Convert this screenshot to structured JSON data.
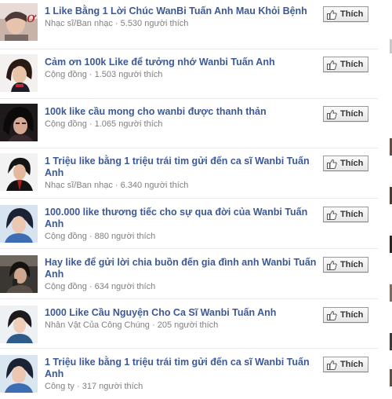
{
  "results": [
    {
      "title": "1 Like Bằng 1 Lời Chúc WanBi Tuấn Anh Mau Khỏi Bệnh",
      "category": "Nhạc sĩ/Ban nhạc",
      "likes": "5.530 người thích",
      "button": "Thích"
    },
    {
      "title": "Cảm ơn 100k Like để tưởng nhớ Wanbi Tuấn Anh",
      "category": "Cộng đồng",
      "likes": "1.503 người thích",
      "button": "Thích"
    },
    {
      "title": "100k like cầu mong cho wanbi được thanh thản",
      "category": "Cộng đồng",
      "likes": "1.065 người thích",
      "button": "Thích"
    },
    {
      "title": "1 Triệu like bằng 1 triệu trái tim gửi đến ca sĩ Wanbi Tuấn Anh",
      "category": "Nhạc sĩ/Ban nhạc",
      "likes": "6.340 người thích",
      "button": "Thích"
    },
    {
      "title": "100.000 like thương tiếc cho sự qua đời của Wanbi Tuấn Anh",
      "category": "Cộng đồng",
      "likes": "880 người thích",
      "button": "Thích"
    },
    {
      "title": "Hay like để gửi lời chia buồn đến gia đình anh Wanbi Tuấn Anh",
      "category": "Cộng đồng",
      "likes": "634 người thích",
      "button": "Thích"
    },
    {
      "title": "1000 Like Cầu Nguyện Cho Ca Sĩ Wanbi Tuấn Anh",
      "category": "Nhân Vật Của Công Chúng",
      "likes": "205 người thích",
      "button": "Thích"
    },
    {
      "title": "1 Triệu like bằng 1 triệu trái tim gửi đến ca sĩ Wanbi Tuấn Anh",
      "category": "Công ty",
      "likes": "317 người thích",
      "button": "Thích"
    }
  ],
  "separator": "·",
  "colors": {
    "link": "#3b5998",
    "meta": "#808080",
    "divider": "#e9e9e9"
  },
  "icons": {
    "like_button": "thumbs-up-icon"
  }
}
